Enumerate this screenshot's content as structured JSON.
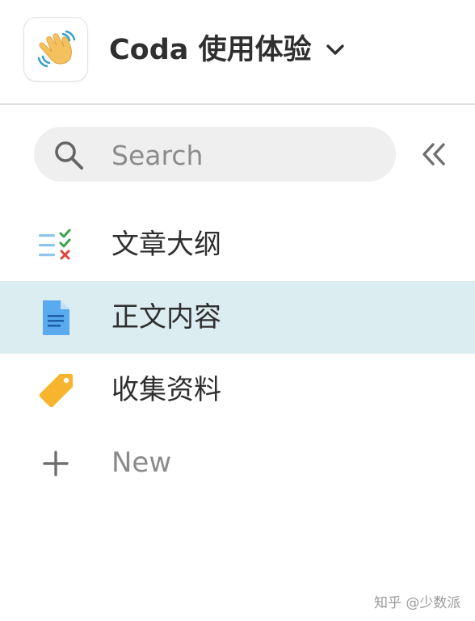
{
  "header": {
    "title": "Coda 使用体验",
    "logo_icon": "waving-hand-icon"
  },
  "search": {
    "placeholder": "Search",
    "value": ""
  },
  "nav": {
    "items": [
      {
        "label": "文章大纲",
        "icon": "checklist-icon",
        "selected": false
      },
      {
        "label": "正文内容",
        "icon": "document-icon",
        "selected": true
      },
      {
        "label": "收集资料",
        "icon": "tag-icon",
        "selected": false
      }
    ],
    "new_label": "New"
  },
  "watermark": "知乎 @少数派",
  "colors": {
    "selected_bg": "#dcedf1",
    "search_bg": "#efefef",
    "check_green": "#3fa34d",
    "cross_red": "#e0453a",
    "doc_blue": "#5aaaf0",
    "tag_orange": "#f7b52e"
  }
}
